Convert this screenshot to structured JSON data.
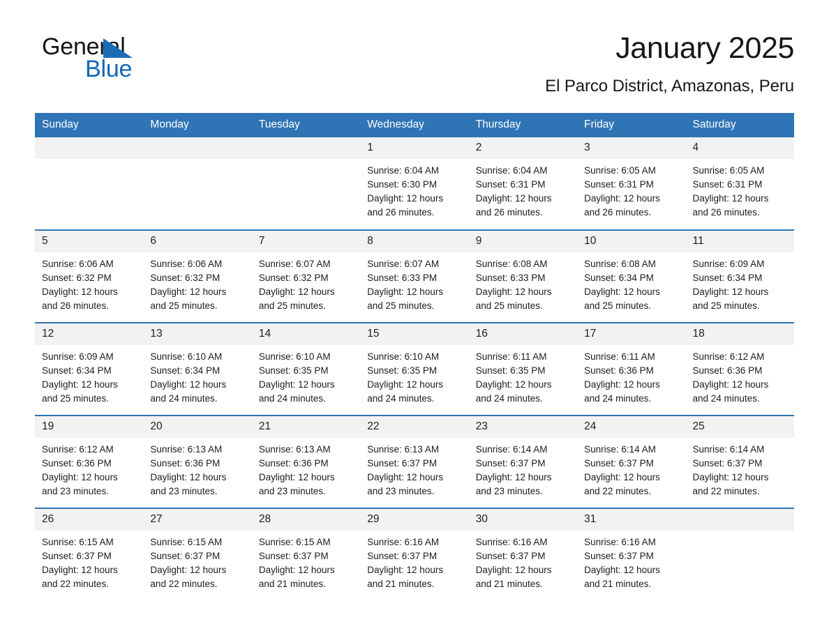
{
  "brand": {
    "name_dark": "General",
    "name_blue": "Blue",
    "triangle_color": "#1a6db5",
    "blue_text_color": "#1266b5"
  },
  "header": {
    "month_title": "January 2025",
    "location": "El Parco District, Amazonas, Peru"
  },
  "theme": {
    "header_bg": "#2f74b5",
    "header_text": "#ffffff",
    "daynum_bg": "#f2f2f2",
    "row_divider": "#2f74b5",
    "body_bg": "#ffffff"
  },
  "calendar": {
    "weekday_headers": [
      "Sunday",
      "Monday",
      "Tuesday",
      "Wednesday",
      "Thursday",
      "Friday",
      "Saturday"
    ],
    "labels": {
      "sunrise_prefix": "Sunrise:",
      "sunset_prefix": "Sunset:",
      "daylight_prefix": "Daylight:"
    },
    "weeks": [
      [
        {
          "day": "",
          "lines": []
        },
        {
          "day": "",
          "lines": []
        },
        {
          "day": "",
          "lines": []
        },
        {
          "day": "1",
          "lines": [
            "Sunrise: 6:04 AM",
            "Sunset: 6:30 PM",
            "Daylight: 12 hours",
            "and 26 minutes."
          ]
        },
        {
          "day": "2",
          "lines": [
            "Sunrise: 6:04 AM",
            "Sunset: 6:31 PM",
            "Daylight: 12 hours",
            "and 26 minutes."
          ]
        },
        {
          "day": "3",
          "lines": [
            "Sunrise: 6:05 AM",
            "Sunset: 6:31 PM",
            "Daylight: 12 hours",
            "and 26 minutes."
          ]
        },
        {
          "day": "4",
          "lines": [
            "Sunrise: 6:05 AM",
            "Sunset: 6:31 PM",
            "Daylight: 12 hours",
            "and 26 minutes."
          ]
        }
      ],
      [
        {
          "day": "5",
          "lines": [
            "Sunrise: 6:06 AM",
            "Sunset: 6:32 PM",
            "Daylight: 12 hours",
            "and 26 minutes."
          ]
        },
        {
          "day": "6",
          "lines": [
            "Sunrise: 6:06 AM",
            "Sunset: 6:32 PM",
            "Daylight: 12 hours",
            "and 25 minutes."
          ]
        },
        {
          "day": "7",
          "lines": [
            "Sunrise: 6:07 AM",
            "Sunset: 6:32 PM",
            "Daylight: 12 hours",
            "and 25 minutes."
          ]
        },
        {
          "day": "8",
          "lines": [
            "Sunrise: 6:07 AM",
            "Sunset: 6:33 PM",
            "Daylight: 12 hours",
            "and 25 minutes."
          ]
        },
        {
          "day": "9",
          "lines": [
            "Sunrise: 6:08 AM",
            "Sunset: 6:33 PM",
            "Daylight: 12 hours",
            "and 25 minutes."
          ]
        },
        {
          "day": "10",
          "lines": [
            "Sunrise: 6:08 AM",
            "Sunset: 6:34 PM",
            "Daylight: 12 hours",
            "and 25 minutes."
          ]
        },
        {
          "day": "11",
          "lines": [
            "Sunrise: 6:09 AM",
            "Sunset: 6:34 PM",
            "Daylight: 12 hours",
            "and 25 minutes."
          ]
        }
      ],
      [
        {
          "day": "12",
          "lines": [
            "Sunrise: 6:09 AM",
            "Sunset: 6:34 PM",
            "Daylight: 12 hours",
            "and 25 minutes."
          ]
        },
        {
          "day": "13",
          "lines": [
            "Sunrise: 6:10 AM",
            "Sunset: 6:34 PM",
            "Daylight: 12 hours",
            "and 24 minutes."
          ]
        },
        {
          "day": "14",
          "lines": [
            "Sunrise: 6:10 AM",
            "Sunset: 6:35 PM",
            "Daylight: 12 hours",
            "and 24 minutes."
          ]
        },
        {
          "day": "15",
          "lines": [
            "Sunrise: 6:10 AM",
            "Sunset: 6:35 PM",
            "Daylight: 12 hours",
            "and 24 minutes."
          ]
        },
        {
          "day": "16",
          "lines": [
            "Sunrise: 6:11 AM",
            "Sunset: 6:35 PM",
            "Daylight: 12 hours",
            "and 24 minutes."
          ]
        },
        {
          "day": "17",
          "lines": [
            "Sunrise: 6:11 AM",
            "Sunset: 6:36 PM",
            "Daylight: 12 hours",
            "and 24 minutes."
          ]
        },
        {
          "day": "18",
          "lines": [
            "Sunrise: 6:12 AM",
            "Sunset: 6:36 PM",
            "Daylight: 12 hours",
            "and 24 minutes."
          ]
        }
      ],
      [
        {
          "day": "19",
          "lines": [
            "Sunrise: 6:12 AM",
            "Sunset: 6:36 PM",
            "Daylight: 12 hours",
            "and 23 minutes."
          ]
        },
        {
          "day": "20",
          "lines": [
            "Sunrise: 6:13 AM",
            "Sunset: 6:36 PM",
            "Daylight: 12 hours",
            "and 23 minutes."
          ]
        },
        {
          "day": "21",
          "lines": [
            "Sunrise: 6:13 AM",
            "Sunset: 6:36 PM",
            "Daylight: 12 hours",
            "and 23 minutes."
          ]
        },
        {
          "day": "22",
          "lines": [
            "Sunrise: 6:13 AM",
            "Sunset: 6:37 PM",
            "Daylight: 12 hours",
            "and 23 minutes."
          ]
        },
        {
          "day": "23",
          "lines": [
            "Sunrise: 6:14 AM",
            "Sunset: 6:37 PM",
            "Daylight: 12 hours",
            "and 23 minutes."
          ]
        },
        {
          "day": "24",
          "lines": [
            "Sunrise: 6:14 AM",
            "Sunset: 6:37 PM",
            "Daylight: 12 hours",
            "and 22 minutes."
          ]
        },
        {
          "day": "25",
          "lines": [
            "Sunrise: 6:14 AM",
            "Sunset: 6:37 PM",
            "Daylight: 12 hours",
            "and 22 minutes."
          ]
        }
      ],
      [
        {
          "day": "26",
          "lines": [
            "Sunrise: 6:15 AM",
            "Sunset: 6:37 PM",
            "Daylight: 12 hours",
            "and 22 minutes."
          ]
        },
        {
          "day": "27",
          "lines": [
            "Sunrise: 6:15 AM",
            "Sunset: 6:37 PM",
            "Daylight: 12 hours",
            "and 22 minutes."
          ]
        },
        {
          "day": "28",
          "lines": [
            "Sunrise: 6:15 AM",
            "Sunset: 6:37 PM",
            "Daylight: 12 hours",
            "and 21 minutes."
          ]
        },
        {
          "day": "29",
          "lines": [
            "Sunrise: 6:16 AM",
            "Sunset: 6:37 PM",
            "Daylight: 12 hours",
            "and 21 minutes."
          ]
        },
        {
          "day": "30",
          "lines": [
            "Sunrise: 6:16 AM",
            "Sunset: 6:37 PM",
            "Daylight: 12 hours",
            "and 21 minutes."
          ]
        },
        {
          "day": "31",
          "lines": [
            "Sunrise: 6:16 AM",
            "Sunset: 6:37 PM",
            "Daylight: 12 hours",
            "and 21 minutes."
          ]
        },
        {
          "day": "",
          "lines": []
        }
      ]
    ]
  }
}
